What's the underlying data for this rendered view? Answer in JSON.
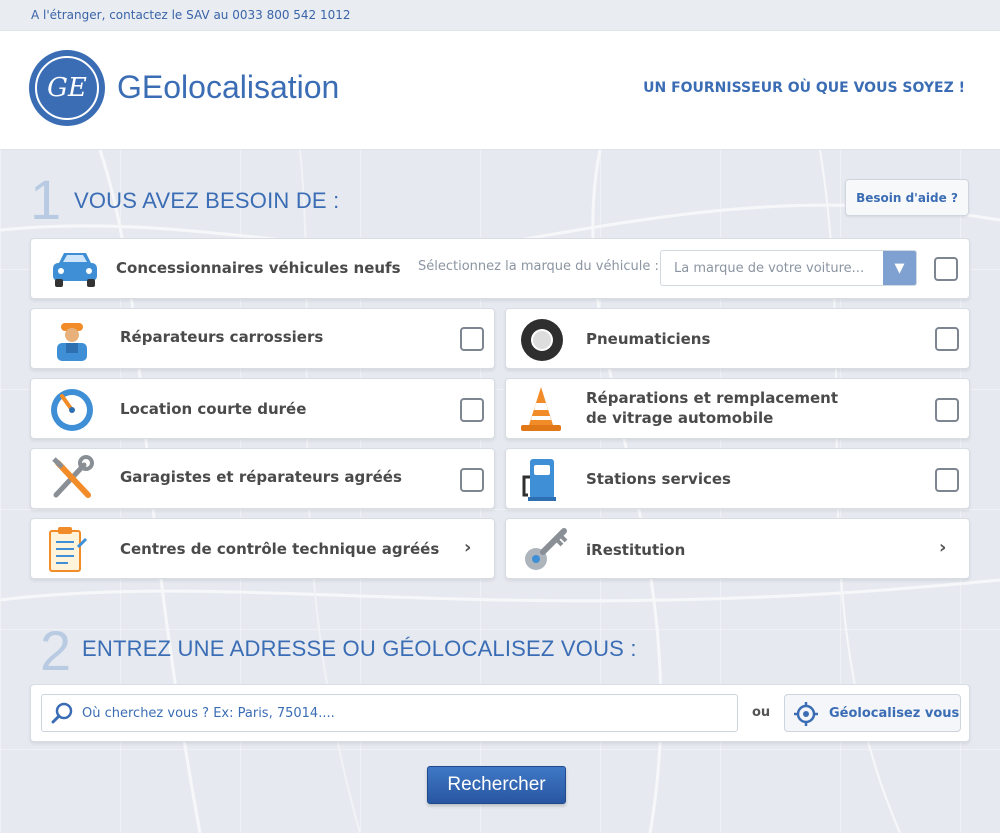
{
  "topbar": {
    "contact": "A l'étranger, contactez le SAV au 0033 800 542 1012"
  },
  "header": {
    "logo_text": "GE",
    "brand": "GEolocalisation",
    "tagline": "UN FOURNISSEUR OÙ QUE VOUS SOYEZ !"
  },
  "step1": {
    "number": "1",
    "title": "VOUS AVEZ BESOIN DE :",
    "help_label": "Besoin d'aide ?"
  },
  "dealer": {
    "label": "Concessionnaires véhicules neufs",
    "select_hint": "Sélectionnez la marque du véhicule :",
    "select_value": "La marque de votre voiture..."
  },
  "services": {
    "carrossiers": "Réparateurs carrossiers",
    "pneumaticiens": "Pneumaticiens",
    "location": "Location courte durée",
    "vitrage": "Réparations et remplacement de vitrage automobile",
    "garagistes": "Garagistes et réparateurs agréés",
    "stations": "Stations services",
    "controle": "Centres de contrôle technique agréés",
    "irestitution": "iRestitution"
  },
  "step2": {
    "number": "2",
    "title": "ENTREZ UNE ADRESSE OU GÉOLOCALISEZ VOUS :",
    "search_placeholder": "Où cherchez vous ? Ex: Paris, 75014....",
    "or": "ou",
    "geo_label": "Géolocalisez vous"
  },
  "submit_label": "Rechercher",
  "colors": {
    "brand": "#3b6db5",
    "submit": "#2f63b0"
  }
}
